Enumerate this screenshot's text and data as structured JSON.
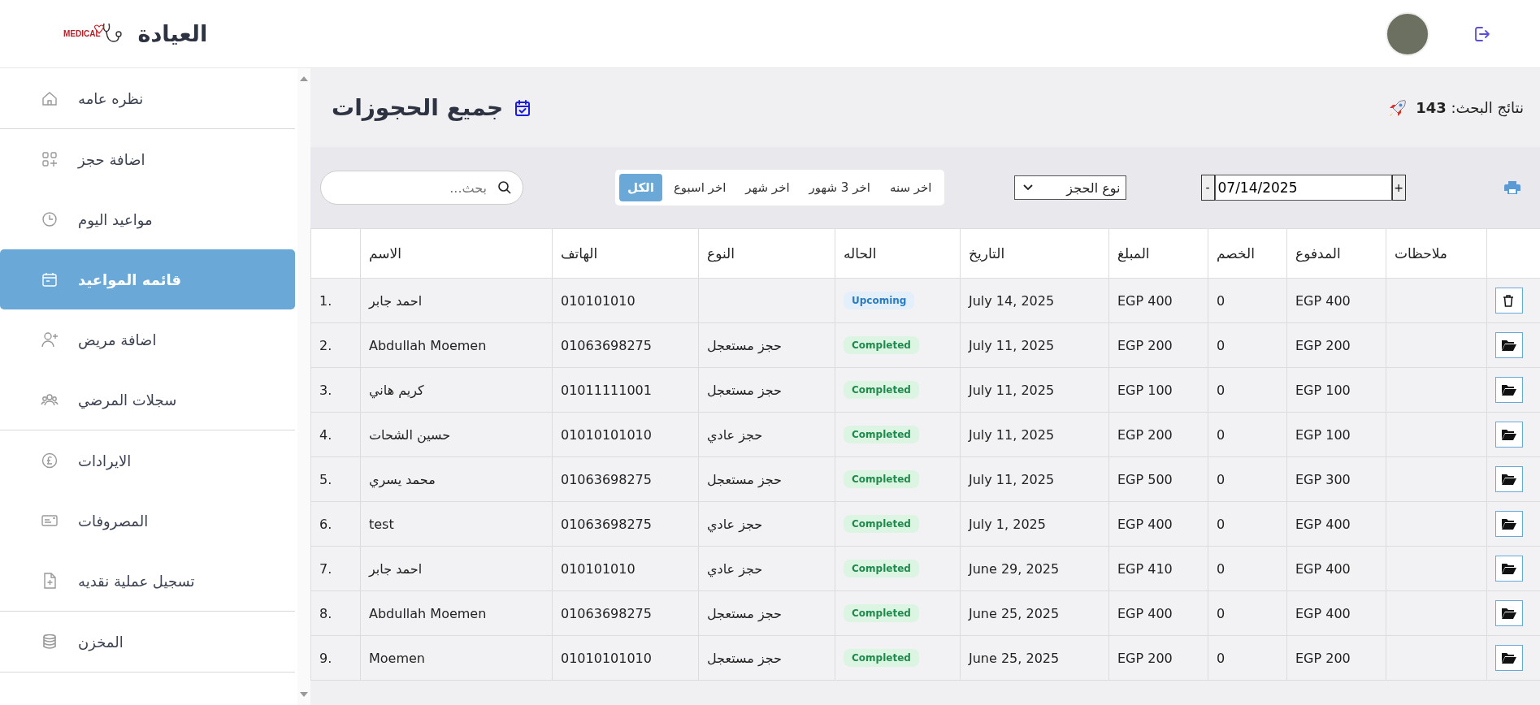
{
  "header": {
    "logo_text": "MEDICAL",
    "title": "العيادة"
  },
  "sidebar": {
    "sections": [
      {
        "items": [
          {
            "label": "نظره عامه",
            "selected": false
          }
        ]
      },
      {
        "items": [
          {
            "label": "اضافة حجز",
            "selected": false
          },
          {
            "label": "مواعيد اليوم",
            "selected": false
          },
          {
            "label": "قائمه المواعيد",
            "selected": true
          },
          {
            "label": "اضافة مريض",
            "selected": false
          },
          {
            "label": "سجلات المرضي",
            "selected": false
          }
        ]
      },
      {
        "items": [
          {
            "label": "الايرادات",
            "selected": false
          },
          {
            "label": "المصروفات",
            "selected": false
          },
          {
            "label": "تسجيل عملية نقديه",
            "selected": false
          }
        ]
      },
      {
        "items": [
          {
            "label": "المخزن",
            "selected": false
          }
        ]
      }
    ]
  },
  "page": {
    "title": "جميع الحجوزات",
    "results": "نتائج البحث: **143**"
  },
  "filters": {
    "search": {
      "placeholder": "بحث..."
    },
    "periods": [
      {
        "label": "اخر سنه",
        "selected": false
      },
      {
        "label": "اخر 3 شهور",
        "selected": false
      },
      {
        "label": "اخر شهر",
        "selected": false
      },
      {
        "label": "اخر اسبوع",
        "selected": false
      },
      {
        "label": "الكل",
        "selected": true
      }
    ],
    "booking_type": {
      "value": "نوع الحجز"
    },
    "date": {
      "decrement": "-",
      "value": "07/14/2025",
      "increment": "+"
    }
  },
  "table": {
    "columns": [
      "ملاحظات",
      "المدفوع",
      "الخصم",
      "المبلغ",
      "التاريخ",
      "الحاله",
      "النوع",
      "الهاتف",
      "الاسم"
    ],
    "rows": [
      {
        "action": {
          "kind": "delete"
        },
        "paid": "EGP 400",
        "discount": "0",
        "amount": "EGP 400",
        "date": "July 14, 2025",
        "status": {
          "text": "Upcoming",
          "kind": "upcoming"
        },
        "phone": "010101010",
        "name": "احمد جابر",
        "index": "1."
      },
      {
        "action": {
          "kind": "open"
        },
        "paid": "EGP 200",
        "discount": "0",
        "amount": "EGP 200",
        "date": "July 11, 2025",
        "status": {
          "text": "Completed",
          "kind": "completed"
        },
        "type": "حجز مستعجل",
        "phone": "01063698275",
        "name": "Abdullah Moemen",
        "index": "2."
      },
      {
        "action": {
          "kind": "open"
        },
        "paid": "EGP 100",
        "discount": "0",
        "amount": "EGP 100",
        "date": "July 11, 2025",
        "status": {
          "text": "Completed",
          "kind": "completed"
        },
        "type": "حجز مستعجل",
        "phone": "01011111001",
        "name": "كريم هاني",
        "index": "3."
      },
      {
        "action": {
          "kind": "open"
        },
        "paid": "EGP 100",
        "discount": "0",
        "amount": "EGP 200",
        "date": "July 11, 2025",
        "status": {
          "text": "Completed",
          "kind": "completed"
        },
        "type": "حجز عادي",
        "phone": "01010101010",
        "name": "حسين الشحات",
        "index": "4."
      },
      {
        "action": {
          "kind": "open"
        },
        "paid": "EGP 300",
        "discount": "0",
        "amount": "EGP 500",
        "date": "July 11, 2025",
        "status": {
          "text": "Completed",
          "kind": "completed"
        },
        "type": "حجز مستعجل",
        "phone": "01063698275",
        "name": "محمد يسري",
        "index": "5."
      },
      {
        "action": {
          "kind": "open"
        },
        "paid": "EGP 400",
        "discount": "0",
        "amount": "EGP 400",
        "date": "July 1, 2025",
        "status": {
          "text": "Completed",
          "kind": "completed"
        },
        "type": "حجز عادي",
        "phone": "01063698275",
        "name": "test",
        "index": "6."
      },
      {
        "action": {
          "kind": "open"
        },
        "paid": "EGP 400",
        "discount": "0",
        "amount": "EGP 410",
        "date": "June 29, 2025",
        "status": {
          "text": "Completed",
          "kind": "completed"
        },
        "type": "حجز عادي",
        "phone": "010101010",
        "name": "احمد جابر",
        "index": "7."
      },
      {
        "action": {
          "kind": "open"
        },
        "paid": "EGP 400",
        "discount": "0",
        "amount": "EGP 400",
        "date": "June 25, 2025",
        "status": {
          "text": "Completed",
          "kind": "completed"
        },
        "type": "حجز مستعجل",
        "phone": "01063698275",
        "name": "Abdullah Moemen",
        "index": "8."
      },
      {
        "action": {
          "kind": "open"
        },
        "paid": "EGP 200",
        "discount": "0",
        "amount": "EGP 200",
        "date": "June 25, 2025",
        "status": {
          "text": "Completed",
          "kind": "completed"
        },
        "type": "حجز مستعجل",
        "phone": "01010101010",
        "name": "Moemen",
        "index": "9."
      }
    ]
  }
}
